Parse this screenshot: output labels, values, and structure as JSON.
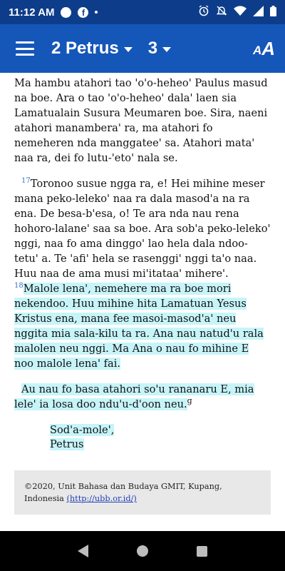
{
  "status_bar": {
    "time": "11:12 AM",
    "icons": [
      "circle-icon",
      "facebook-icon",
      "alarm-icon",
      "notifications-off-icon",
      "wifi-icon",
      "signal-icon",
      "battery-icon"
    ]
  },
  "app_bar": {
    "book": "2 Petrus",
    "chapter": "3",
    "font_button_icon": "text-size-icon"
  },
  "content": {
    "p1": "Ma hambu atahori tao 'o'o-heheo' Paulus masud na boe. Ara o tao 'o'o-heheo' dala' laen sia Lamatualain Susura Meumaren boe. Sira, naeni atahori manambera' ra, ma atahori fo nemeheren nda manggatee' sa. Atahori mata' naa ra, dei fo lutu-'eto' nala se.",
    "v17_num": "17",
    "v17_text": "Toronoo susue ngga ra, e! Hei mihine meser mana peko-leleko' naa ra dala masod'a na ra ena. De besa-b'esa, o! Te ara nda nau rena hohoro-lalane' saa sa boe. Ara sob'a peko-leleko' nggi, naa fo ama dinggo' lao hela dala ndoo-tetu' a. Te 'afi' hela se rasenggi' nggi ta'o naa. Huu naa de ama musi mi'itataa' mihere'.",
    "v18_num": "18",
    "v18_text": "Malole lena', nemehere ma ra boe mori nekendoo. Huu mihine hita Lamatuan Yesus Kristus ena, mana fee masoi-masod'a' neu nggita mia sala-kilu ta ra. Ana nau natud'u rala malolen neu nggi. Ma Ana o nau fo mihine E noo malole lena' fai.",
    "p3": "Au nau fo basa atahori so'u rananaru E, mia lele' ia losa doo ndu'u-d'oon neu.",
    "p3_footnote": "g",
    "closing_line1": "Sod'a-mole',",
    "closing_line2": "Petrus",
    "copyright_text": "©2020, Unit Bahasa dan Budaya GMIT, Kupang, Indonesia ",
    "copyright_link": "(http://ubb.or.id/)"
  },
  "colors": {
    "status_bar": "#0d3d8a",
    "app_bar": "#1556b9",
    "highlight": "#c7f4f9",
    "verse_number": "#3a6fc4",
    "copyright_bg": "#e8e8e8"
  }
}
